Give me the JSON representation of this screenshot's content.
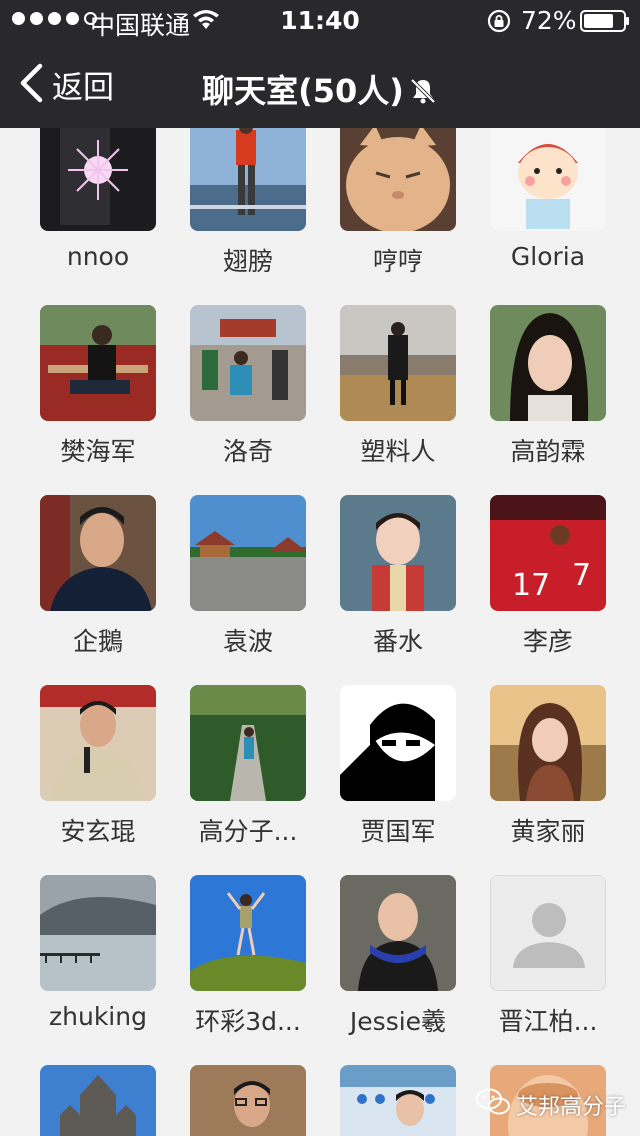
{
  "status_bar": {
    "carrier": "中国联通",
    "time": "11:40",
    "battery": "72%"
  },
  "nav": {
    "back_label": "返回",
    "title": "聊天室(50人)"
  },
  "members": [
    {
      "name": "nnoo"
    },
    {
      "name": "翅膀"
    },
    {
      "name": "哼哼"
    },
    {
      "name": "Gloria"
    },
    {
      "name": "樊海军"
    },
    {
      "name": "洛奇"
    },
    {
      "name": "塑料人"
    },
    {
      "name": "高韵霖"
    },
    {
      "name": "企鵝"
    },
    {
      "name": "袁波"
    },
    {
      "name": "番水"
    },
    {
      "name": "李彦"
    },
    {
      "name": "安玄琨"
    },
    {
      "name": "高分子..."
    },
    {
      "name": "贾国军"
    },
    {
      "name": "黄家丽"
    },
    {
      "name": "zhuking"
    },
    {
      "name": "环彩3d..."
    },
    {
      "name": "Jessie羲"
    },
    {
      "name": "晋江柏..."
    },
    {
      "name": ""
    },
    {
      "name": ""
    },
    {
      "name": ""
    },
    {
      "name": ""
    }
  ],
  "watermark": "艾邦高分子",
  "colors": {
    "nav_bg": "#29292b",
    "page_bg": "#f2f2f2"
  }
}
